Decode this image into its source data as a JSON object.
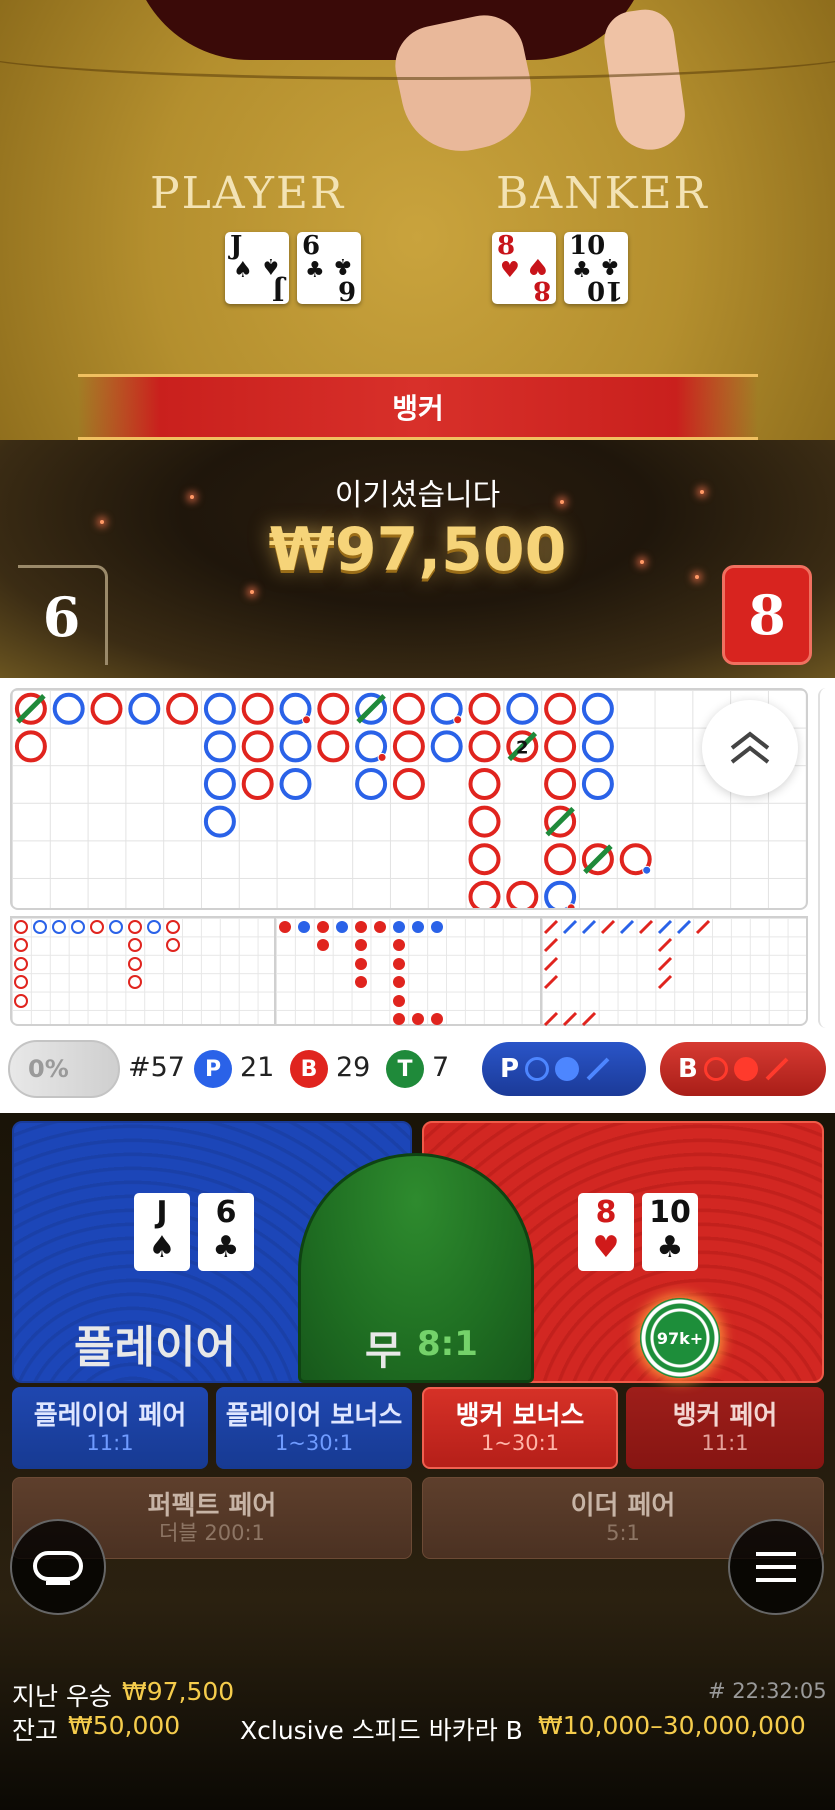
{
  "table": {
    "player_label": "PLAYER",
    "banker_label": "BANKER",
    "player_cards": [
      {
        "rank": "J",
        "suit": "♠",
        "red": false
      },
      {
        "rank": "6",
        "suit": "♣",
        "red": false
      }
    ],
    "banker_cards": [
      {
        "rank": "8",
        "suit": "♥",
        "red": true
      },
      {
        "rank": "10",
        "suit": "♣",
        "red": false
      }
    ],
    "result_banner": "뱅커",
    "win_label": "이기셨습니다",
    "win_amount": "₩97,500",
    "player_score": "6",
    "banker_score": "8"
  },
  "stats": {
    "percent": "0%",
    "round": "#57",
    "p_badge": "P",
    "p_count": "21",
    "b_badge": "B",
    "b_count": "29",
    "t_badge": "T",
    "t_count": "7",
    "ask_p": "P",
    "ask_b": "B"
  },
  "bets": {
    "player_label": "플레이어",
    "tie_label": "무",
    "tie_odds": "8:1",
    "chip_label": "97k+",
    "player_cards": [
      {
        "rank": "J",
        "suit": "♠",
        "red": false
      },
      {
        "rank": "6",
        "suit": "♣",
        "red": false
      }
    ],
    "banker_cards": [
      {
        "rank": "8",
        "suit": "♥",
        "red": true
      },
      {
        "rank": "10",
        "suit": "♣",
        "red": false
      }
    ],
    "side_bets": [
      {
        "title": "플레이어 페어",
        "odds": "11:1"
      },
      {
        "title": "플레이어 보너스",
        "odds": "1~30:1"
      },
      {
        "title": "뱅커 보너스",
        "odds": "1~30:1"
      },
      {
        "title": "뱅커 페어",
        "odds": "11:1"
      },
      {
        "title": "퍼펙트 페어",
        "odds": "더블 200:1"
      },
      {
        "title": "이더 페어",
        "odds": "5:1"
      }
    ]
  },
  "footer": {
    "last_win_label": "지난 우승",
    "last_win_value": "₩97,500",
    "time": "# 22:32:05",
    "balance_label": "잔고",
    "balance_value": "₩50,000",
    "table_name": "Xclusive 스피드 바카라 B",
    "limits": "₩10,000–30,000,000"
  },
  "colors": {
    "player_blue": "#2a62e8",
    "banker_red": "#e0241e",
    "tie_green": "#1f8a3a",
    "gold": "#f5cc4c"
  },
  "roadmap": {
    "big_road": [
      {
        "col": 0,
        "row": 0,
        "c": "R",
        "tie": true
      },
      {
        "col": 0,
        "row": 1,
        "c": "R"
      },
      {
        "col": 1,
        "row": 0,
        "c": "B"
      },
      {
        "col": 2,
        "row": 0,
        "c": "R"
      },
      {
        "col": 3,
        "row": 0,
        "c": "B"
      },
      {
        "col": 4,
        "row": 0,
        "c": "R"
      },
      {
        "col": 5,
        "row": 0,
        "c": "B"
      },
      {
        "col": 5,
        "row": 1,
        "c": "B"
      },
      {
        "col": 5,
        "row": 2,
        "c": "B"
      },
      {
        "col": 5,
        "row": 3,
        "c": "B"
      },
      {
        "col": 6,
        "row": 0,
        "c": "R"
      },
      {
        "col": 6,
        "row": 1,
        "c": "R"
      },
      {
        "col": 6,
        "row": 2,
        "c": "R"
      },
      {
        "col": 7,
        "row": 0,
        "c": "B",
        "pair": true
      },
      {
        "col": 7,
        "row": 1,
        "c": "B"
      },
      {
        "col": 7,
        "row": 2,
        "c": "B"
      },
      {
        "col": 8,
        "row": 0,
        "c": "R"
      },
      {
        "col": 8,
        "row": 1,
        "c": "R"
      },
      {
        "col": 9,
        "row": 0,
        "c": "B",
        "tie": true
      },
      {
        "col": 9,
        "row": 1,
        "c": "B",
        "pair": true
      },
      {
        "col": 9,
        "row": 2,
        "c": "B"
      },
      {
        "col": 10,
        "row": 0,
        "c": "R"
      },
      {
        "col": 10,
        "row": 1,
        "c": "R"
      },
      {
        "col": 10,
        "row": 2,
        "c": "R"
      },
      {
        "col": 11,
        "row": 0,
        "c": "B",
        "pair": true
      },
      {
        "col": 11,
        "row": 1,
        "c": "B"
      },
      {
        "col": 12,
        "row": 0,
        "c": "R"
      },
      {
        "col": 12,
        "row": 1,
        "c": "R"
      },
      {
        "col": 12,
        "row": 2,
        "c": "R"
      },
      {
        "col": 12,
        "row": 3,
        "c": "R"
      },
      {
        "col": 12,
        "row": 4,
        "c": "R"
      },
      {
        "col": 12,
        "row": 5,
        "c": "R"
      },
      {
        "col": 13,
        "row": 0,
        "c": "B"
      },
      {
        "col": 13,
        "row": 1,
        "c": "R",
        "tie": true,
        "num": "2"
      },
      {
        "col": 13,
        "row": 5,
        "c": "R"
      },
      {
        "col": 14,
        "row": 0,
        "c": "R"
      },
      {
        "col": 14,
        "row": 1,
        "c": "R"
      },
      {
        "col": 14,
        "row": 2,
        "c": "R"
      },
      {
        "col": 14,
        "row": 3,
        "c": "R",
        "tie": true
      },
      {
        "col": 14,
        "row": 4,
        "c": "R"
      },
      {
        "col": 14,
        "row": 5,
        "c": "B",
        "pair": true
      },
      {
        "col": 15,
        "row": 0,
        "c": "B"
      },
      {
        "col": 15,
        "row": 1,
        "c": "B"
      },
      {
        "col": 15,
        "row": 2,
        "c": "B"
      },
      {
        "col": 15,
        "row": 4,
        "c": "R",
        "tie": true
      },
      {
        "col": 16,
        "row": 4,
        "c": "R",
        "pair": true
      }
    ]
  }
}
